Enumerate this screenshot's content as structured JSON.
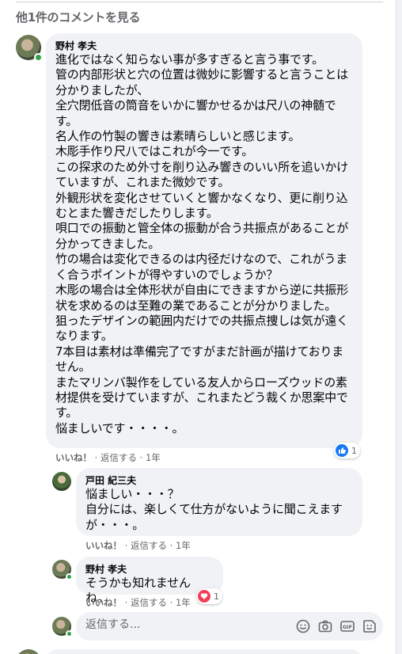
{
  "view_more_label": "他1件のコメントを見る",
  "comments": [
    {
      "author": "野村 孝夫",
      "text": "進化ではなく知らない事が多すぎると言う事です。\n管の内部形状と穴の位置は微妙に影響すると言うことは分かりましたが、\n全穴閉低音の筒音をいかに響かせるかは尺八の神髄です。\n名人作の竹製の響きは素晴らしいと感じます。\n木彫手作り尺八ではこれが今一です。\nこの探求のため外寸を削り込み響きのいい所を追いかけていますが、これまた微妙です。\n外観形状を変化させていくと響かなくなり、更に削り込むとまた響きだしたりします。\n唄口での振動と管全体の振動が合う共振点があることが分かってきました。\n竹の場合は変化できるのは内径だけなので、これがうまく合うポイントが得やすいのでしょうか？\n木彫の場合は全体形状が自由にできますから逆に共振形状を求めるのは至難の業であることが分かりました。\n狙ったデザインの範囲内だけでの共振点捜しは気が遠くなります。\n7本目は素材は準備完了ですがまだ計画が描けておりません。\nまたマリンバ製作をしている友人からローズウッドの素材提供を受けていますが、これまたどう裁くか思案中です。\n悩ましいです・・・・。",
      "like_label": "いいね！",
      "reply_label": "返信する",
      "time": "1年",
      "reaction_icon": "like-icon",
      "reaction_count": "1"
    },
    {
      "author": "戸田 紀三夫",
      "text": "悩ましい・・・？\n自分には、楽しくて仕方がないように聞こえますが・・・。",
      "like_label": "いいね！",
      "reply_label": "返信する",
      "time": "1年"
    },
    {
      "author": "野村 孝夫",
      "text": "そうかも知れませんね。",
      "like_label": "いいね！",
      "reply_label": "返信する",
      "time": "1年",
      "reaction_icon": "love-icon",
      "reaction_count": "1"
    }
  ],
  "reply_box": {
    "placeholder": "返信する..."
  },
  "colors": {
    "bubble": "#f0f2f5",
    "secondary_text": "#65676b",
    "like_blue": "#1877f2",
    "love_red": "#f33e58",
    "online_green": "#31a24c"
  }
}
